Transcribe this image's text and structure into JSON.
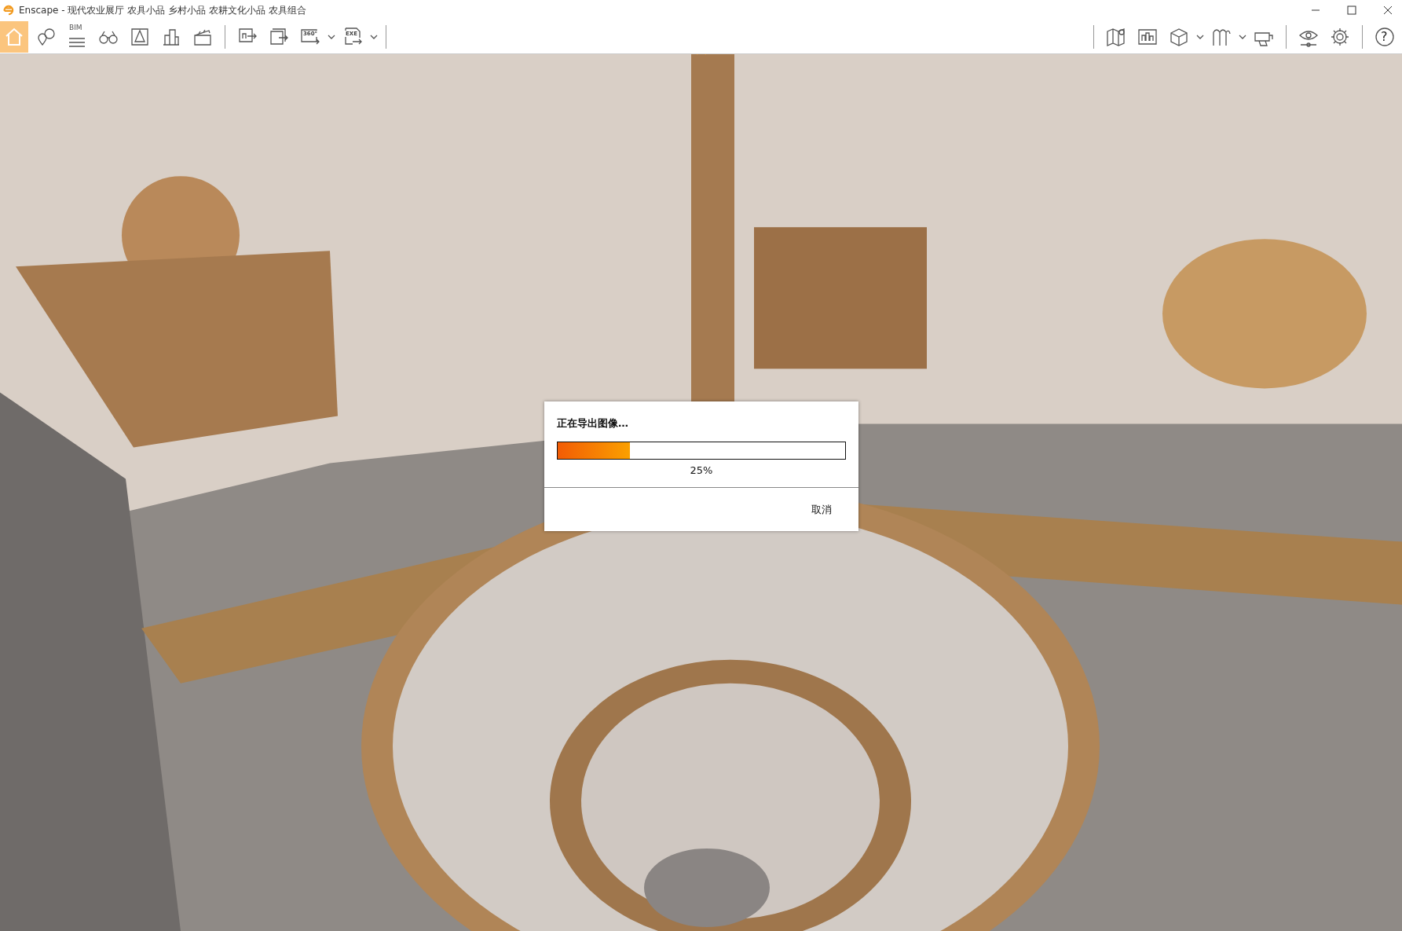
{
  "window": {
    "title": "Enscape - 现代农业展厅 农具小品 乡村小品 农耕文化小品 农具组合"
  },
  "toolbar_left": [
    [
      {
        "kind": "button",
        "selected": true
      },
      {
        "kind": "button",
        "selected": false
      },
      {
        "kind": "button",
        "label": "BIM",
        "selected": false
      },
      {
        "kind": "button",
        "selected": false
      },
      {
        "kind": "button",
        "selected": false
      },
      {
        "kind": "button",
        "selected": false
      },
      {
        "kind": "button",
        "selected": false
      }
    ],
    [
      {
        "kind": "button",
        "selected": false
      },
      {
        "kind": "button",
        "selected": false
      },
      {
        "kind": "dropdown",
        "label": "360°",
        "selected": false
      },
      {
        "kind": "dropdown",
        "label": "EXE",
        "selected": false
      }
    ]
  ],
  "toolbar_right": [
    [
      {
        "kind": "button",
        "selected": false
      },
      {
        "kind": "button",
        "selected": false
      },
      {
        "kind": "dropdown",
        "selected": false
      },
      {
        "kind": "dropdown",
        "selected": false
      },
      {
        "kind": "button",
        "selected": false
      }
    ],
    [
      {
        "kind": "button",
        "selected": false
      },
      {
        "kind": "button",
        "selected": false
      }
    ],
    [
      {
        "kind": "button",
        "label": "?",
        "selected": false
      }
    ]
  ],
  "viewport": {
    "kind": "picture"
  },
  "dialog": {
    "title": "正在导出图像…",
    "progress": {
      "level": 0.25,
      "reading": "25%"
    },
    "buttons": [
      "取消"
    ]
  }
}
